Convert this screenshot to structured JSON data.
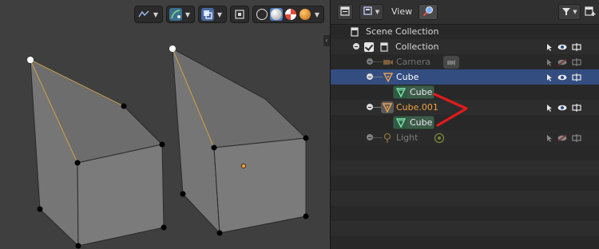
{
  "outliner": {
    "view_menu_label": "View",
    "rows": {
      "scene_collection": "Scene Collection",
      "collection": "Collection",
      "camera": "Camera",
      "cube": "Cube",
      "cube_mesh": "Cube",
      "cube001": "Cube.001",
      "cube001_mesh": "Cube",
      "light": "Light"
    }
  },
  "colors": {
    "viewport_bg": "#3f3f3f",
    "outliner_bg": "#282828",
    "selection_row": "#334d80",
    "active_object_text": "#f0a341",
    "annotation": "#e01b1b",
    "mesh_icon": "#5fc38b"
  },
  "icons": {
    "viewport_header": [
      "select-mode-icon",
      "gizmo-icon",
      "overlays-icon",
      "xray-icon",
      "wireframe-shading-icon",
      "solid-shading-icon",
      "material-preview-icon",
      "rendered-shading-icon"
    ],
    "outliner_header": [
      "editor-type-icon",
      "display-mode-icon",
      "search-icon",
      "filter-icon",
      "new-collection-icon"
    ],
    "row_controls": [
      "select-arrow-icon",
      "eye-icon",
      "camera-render-icon"
    ]
  }
}
